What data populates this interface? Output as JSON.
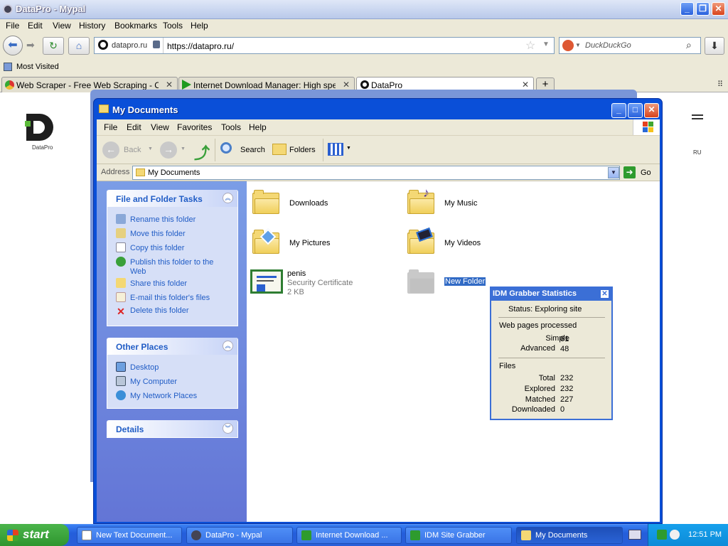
{
  "browser": {
    "title": "DataPro - Mypal",
    "menu": [
      "File",
      "Edit",
      "View",
      "History",
      "Bookmarks",
      "Tools",
      "Help"
    ],
    "site_identity": "datapro.ru",
    "url": "https://datapro.ru/",
    "search_placeholder": "DuckDuckGo",
    "bookmark": "Most Visited",
    "tabs": [
      {
        "title": "Web Scraper - Free Web Scraping - Chro..."
      },
      {
        "title": "Internet Download Manager: High speed ..."
      },
      {
        "title": "DataPro"
      }
    ]
  },
  "site": {
    "logo_text": "DataPro",
    "lang_current": "RU"
  },
  "explorer": {
    "title": "My Documents",
    "menu": [
      "File",
      "Edit",
      "View",
      "Favorites",
      "Tools",
      "Help"
    ],
    "toolbar": {
      "back": "Back",
      "search": "Search",
      "folders": "Folders"
    },
    "address_label": "Address",
    "address_value": "My Documents",
    "go_label": "Go",
    "tasks_header": "File and Folder Tasks",
    "tasks": [
      "Rename this folder",
      "Move this folder",
      "Copy this folder",
      "Publish this folder to the Web",
      "Share this folder",
      "E-mail this folder's files",
      "Delete this folder"
    ],
    "places_header": "Other Places",
    "places": [
      "Desktop",
      "My Computer",
      "My Network Places"
    ],
    "details_header": "Details",
    "items": [
      {
        "name": "Downloads"
      },
      {
        "name": "My Music"
      },
      {
        "name": "My Pictures"
      },
      {
        "name": "My Videos"
      },
      {
        "name": "penis",
        "type": "Security Certificate",
        "size": "2 KB"
      },
      {
        "name": "New Folder"
      }
    ]
  },
  "idm_stats": {
    "title": "IDM Grabber Statistics",
    "status": "Status: Exploring site",
    "pages_header": "Web pages processed",
    "simple_label": "Simple",
    "simple_value": "61",
    "advanced_label": "Advanced",
    "advanced_value": "48",
    "files_header": "Files",
    "total_label": "Total",
    "total_value": "232",
    "explored_label": "Explored",
    "explored_value": "232",
    "matched_label": "Matched",
    "matched_value": "227",
    "downloaded_label": "Downloaded",
    "downloaded_value": "0"
  },
  "taskbar": {
    "start": "start",
    "buttons": [
      {
        "label": "New Text Document..."
      },
      {
        "label": "DataPro - Mypal"
      },
      {
        "label": "Internet Download ..."
      },
      {
        "label": "IDM Site Grabber"
      },
      {
        "label": "My Documents"
      }
    ],
    "clock": "12:51 PM"
  },
  "colors": {
    "xp_blue": "#0a4fd8",
    "link_blue": "#215dc6",
    "folder_yellow": "#f4d875"
  }
}
